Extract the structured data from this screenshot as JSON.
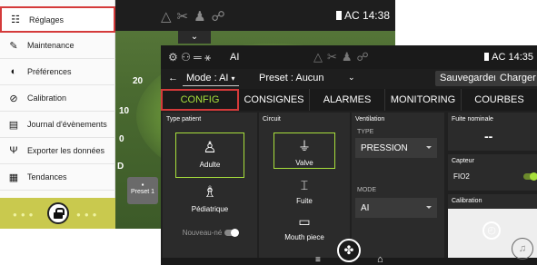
{
  "menu": {
    "items": [
      {
        "label": "Réglages",
        "icon": "sliders-icon",
        "glyph": "☷"
      },
      {
        "label": "Maintenance",
        "icon": "wrench-icon",
        "glyph": "🔧"
      },
      {
        "label": "Préférences",
        "icon": "preferences-icon",
        "glyph": "◐"
      },
      {
        "label": "Calibration",
        "icon": "calibration-icon",
        "glyph": "⊘"
      },
      {
        "label": "Journal d'évènements",
        "icon": "journal-icon",
        "glyph": "▤"
      },
      {
        "label": "Exporter les données",
        "icon": "usb-icon",
        "glyph": "Ψ"
      },
      {
        "label": "Tendances",
        "icon": "grid-icon",
        "glyph": "▦"
      }
    ]
  },
  "back": {
    "time": "AC 14:38",
    "y_labels": [
      "20",
      "10",
      "0"
    ],
    "d_label": "D",
    "preset_label": "Preset 1"
  },
  "front": {
    "status": {
      "mode_short": "AI",
      "time": "AC 14:35"
    },
    "toolbar": {
      "back": "←",
      "mode": "Mode : AI",
      "preset": "Preset : Aucun",
      "save": "Sauvegarder",
      "load": "Charger"
    },
    "tabs": [
      "CONFIG",
      "CONSIGNES",
      "ALARMES",
      "MONITORING",
      "COURBES"
    ],
    "type_patient": {
      "title": "Type patient",
      "adult": "Adulte",
      "pediatric": "Pédiatrique",
      "newborn": "Nouveau-né"
    },
    "circuit": {
      "title": "Circuit",
      "valve": "Valve",
      "leak": "Fuite",
      "mouthpiece": "Mouth piece"
    },
    "ventilation": {
      "title": "Ventilation",
      "type_label": "TYPE",
      "type_value": "PRESSION",
      "mode_label": "MODE",
      "mode_value": "AI"
    },
    "leak": {
      "title": "Fuite nominale",
      "value": "--"
    },
    "sensor": {
      "title": "Capteur",
      "item": "FIO2"
    },
    "calibration": {
      "title": "Calibration"
    }
  },
  "colors": {
    "accent": "#a8e03c",
    "highlight": "#d43a3a",
    "lockbar": "#c9c94e"
  }
}
